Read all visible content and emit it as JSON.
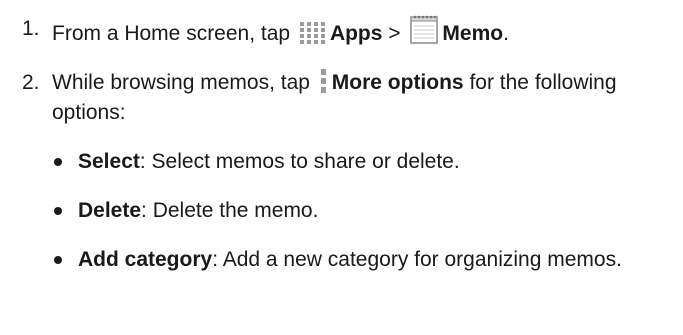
{
  "steps": [
    {
      "number": "1.",
      "text_before": "From a Home screen, tap",
      "apps_label": "Apps",
      "separator": " >",
      "memo_label": "Memo",
      "end": "."
    },
    {
      "number": "2.",
      "text_before": "While browsing memos, tap",
      "more_label": "More options",
      "text_after": " for the following options:"
    }
  ],
  "options": [
    {
      "term": "Select",
      "desc": ": Select memos to share or delete."
    },
    {
      "term": "Delete",
      "desc": ": Delete the memo."
    },
    {
      "term": "Add category",
      "desc": ": Add a new category for organizing memos."
    }
  ],
  "icons": {
    "apps": "apps-grid-icon",
    "memo": "memo-notepad-icon",
    "more": "more-options-icon"
  },
  "colors": {
    "text": "#1a1a1a",
    "icon_gray": "#9a9a9a",
    "memo_border": "#8a8a8a"
  }
}
